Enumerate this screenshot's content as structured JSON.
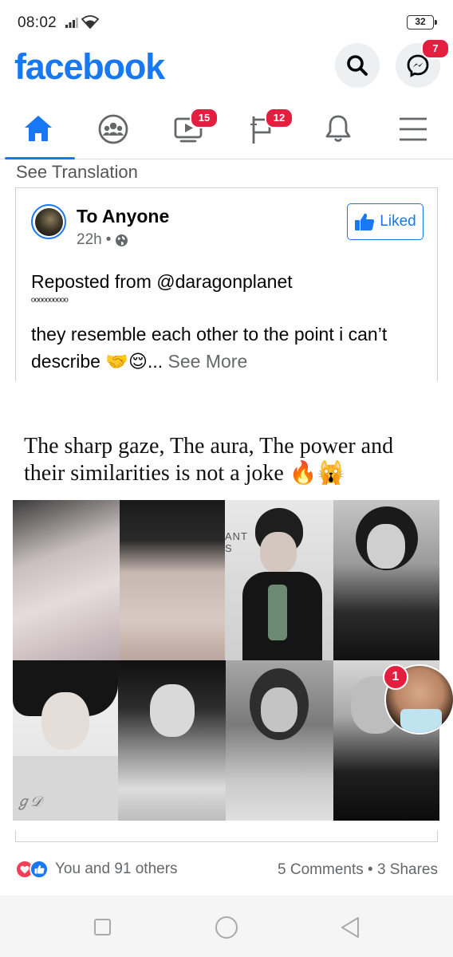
{
  "status_bar": {
    "time": "08:02",
    "battery": "32"
  },
  "header": {
    "logo": "facebook",
    "search_icon": "search-icon",
    "messenger_icon": "messenger-icon",
    "messenger_badge": "7"
  },
  "tabs": [
    {
      "name": "home",
      "icon": "home-icon",
      "active": true,
      "badge": ""
    },
    {
      "name": "groups",
      "icon": "groups-icon",
      "active": false,
      "badge": ""
    },
    {
      "name": "watch",
      "icon": "watch-icon",
      "active": false,
      "badge": "15"
    },
    {
      "name": "pages",
      "icon": "pages-icon",
      "active": false,
      "badge": "12"
    },
    {
      "name": "notifications",
      "icon": "bell-icon",
      "active": false,
      "badge": ""
    },
    {
      "name": "menu",
      "icon": "menu-icon",
      "active": false,
      "badge": ""
    }
  ],
  "post": {
    "see_translation": "See Translation",
    "shared": {
      "author": "To Anyone",
      "time": "22h",
      "separator": "•",
      "privacy_icon": "globe-icon",
      "liked_label": "Liked",
      "line1": "Reposted from @daragonplanet",
      "dots": "ºººººººººº",
      "line2": " they resemble each other to the point i can’t describe 🤝😌",
      "ellipsis": "...",
      "see_more": "See More"
    },
    "image": {
      "caption": "The sharp gaze, The aura, The  power and their similarities is not a joke 🔥🙀",
      "brand_text": "ANT\nS",
      "signature": "ℊ𝒟"
    },
    "chat_head_badge": "1",
    "reactions": {
      "icons": [
        "love-icon",
        "like-icon"
      ],
      "text": "You and 91 others"
    },
    "engagement": "5 Comments • 3 Shares"
  },
  "colors": {
    "brand": "#1877f2",
    "badge": "#e41e3f",
    "love": "#f33e58",
    "muted": "#65676b"
  }
}
